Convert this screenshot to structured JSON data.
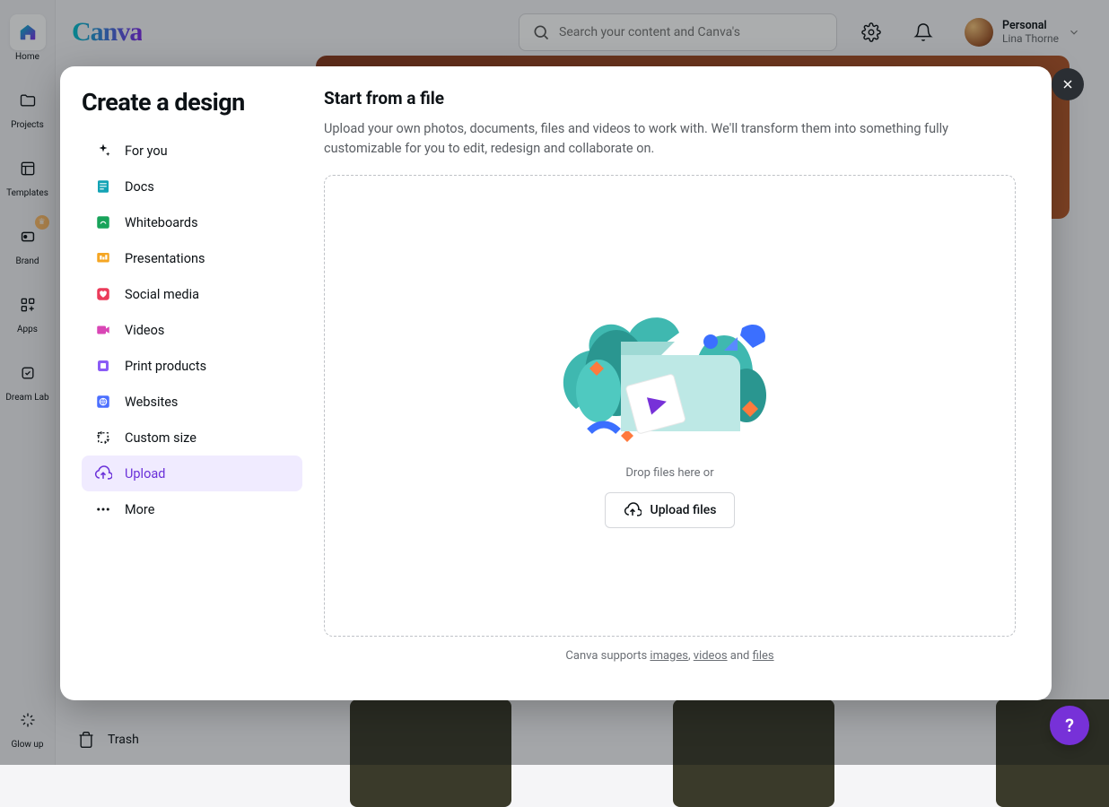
{
  "rail": {
    "items": [
      {
        "label": "Home"
      },
      {
        "label": "Projects"
      },
      {
        "label": "Templates"
      },
      {
        "label": "Brand"
      },
      {
        "label": "Apps"
      },
      {
        "label": "Dream Lab"
      }
    ],
    "glow": "Glow up"
  },
  "header": {
    "logo": "Canva",
    "search_placeholder": "Search your content and Canva's",
    "account": {
      "type": "Personal",
      "name": "Lina Thorne"
    }
  },
  "bg": {
    "trash": "Trash"
  },
  "modal": {
    "title": "Create a design",
    "categories": [
      {
        "label": "For you"
      },
      {
        "label": "Docs"
      },
      {
        "label": "Whiteboards"
      },
      {
        "label": "Presentations"
      },
      {
        "label": "Social media"
      },
      {
        "label": "Videos"
      },
      {
        "label": "Print products"
      },
      {
        "label": "Websites"
      },
      {
        "label": "Custom size"
      },
      {
        "label": "Upload"
      },
      {
        "label": "More"
      }
    ],
    "main": {
      "title": "Start from a file",
      "desc": "Upload your own photos, documents, files and videos to work with. We'll transform them into something fully customizable for you to edit, redesign and collaborate on.",
      "drop_text": "Drop files here or",
      "upload_btn": "Upload files",
      "support_prefix": "Canva supports ",
      "support_images": "images",
      "support_sep1": ", ",
      "support_videos": "videos",
      "support_sep2": " and ",
      "support_files": "files"
    }
  },
  "help": "?"
}
